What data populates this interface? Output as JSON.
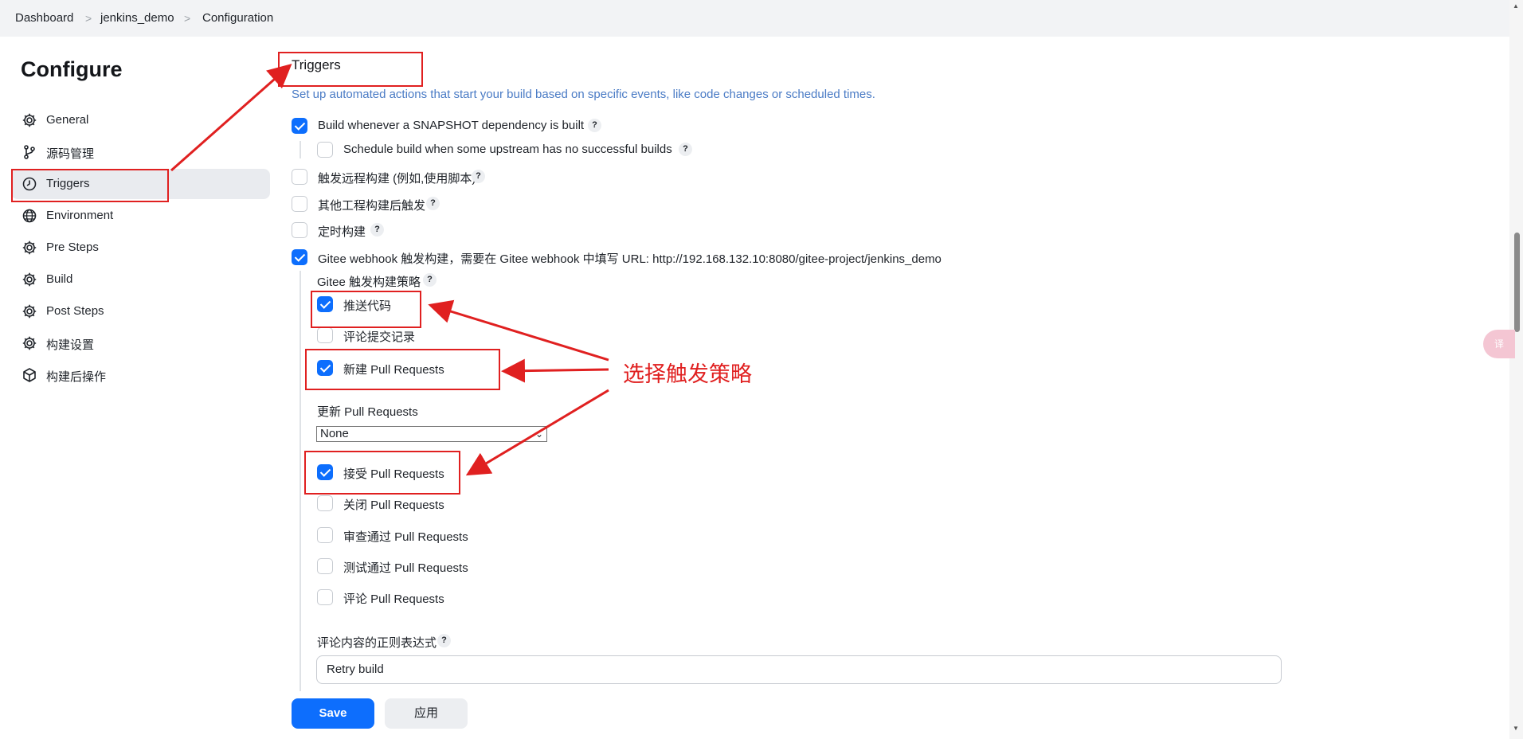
{
  "breadcrumb": [
    "Dashboard",
    "jenkins_demo",
    "Configuration"
  ],
  "breadcrumb_separator": ">",
  "sidebar": {
    "title": "Configure",
    "items": [
      {
        "label": "General",
        "icon": "gear-icon"
      },
      {
        "label": "源码管理",
        "icon": "branch-icon"
      },
      {
        "label": "Triggers",
        "icon": "clock-icon",
        "active": true
      },
      {
        "label": "Environment",
        "icon": "globe-icon"
      },
      {
        "label": "Pre Steps",
        "icon": "gear-icon"
      },
      {
        "label": "Build",
        "icon": "gear-icon"
      },
      {
        "label": "Post Steps",
        "icon": "gear-icon"
      },
      {
        "label": "构建设置",
        "icon": "gear-icon"
      },
      {
        "label": "构建后操作",
        "icon": "cube-icon"
      }
    ]
  },
  "section": {
    "title": "Triggers",
    "description": "Set up automated actions that start your build based on specific events, like code changes or scheduled times."
  },
  "triggers": {
    "snapshot": {
      "label": "Build whenever a SNAPSHOT dependency is built",
      "checked": true
    },
    "upstream": {
      "label": "Schedule build when some upstream has no successful builds",
      "checked": false
    },
    "remote": {
      "label": "触发远程构建 (例如,使用脚本)",
      "checked": false
    },
    "after_other": {
      "label": "其他工程构建后触发",
      "checked": false
    },
    "scheduled": {
      "label": "定时构建",
      "checked": false
    },
    "gitee": {
      "label": "Gitee webhook 触发构建，需要在 Gitee webhook 中填写 URL: http://192.168.132.10:8080/gitee-project/jenkins_demo",
      "checked": true
    }
  },
  "gitee": {
    "strategy_label": "Gitee 触发构建策略",
    "push": {
      "label": "推送代码",
      "checked": true
    },
    "comment_commit": {
      "label": "评论提交记录",
      "checked": false
    },
    "new_pr": {
      "label": "新建 Pull Requests",
      "checked": true
    },
    "update_pr_label": "更新 Pull Requests",
    "update_pr_value": "None",
    "accept_pr": {
      "label": "接受 Pull Requests",
      "checked": true
    },
    "close_pr": {
      "label": "关闭 Pull Requests",
      "checked": false
    },
    "review_pr": {
      "label": "审查通过 Pull Requests",
      "checked": false
    },
    "test_pr": {
      "label": "测试通过 Pull Requests",
      "checked": false
    },
    "comment_pr": {
      "label": "评论 Pull Requests",
      "checked": false
    },
    "regex_label": "评论内容的正则表达式",
    "regex_value": "Retry build"
  },
  "help_mark": "?",
  "buttons": {
    "save": "Save",
    "apply": "应用"
  },
  "translate_fab": "译",
  "annotation": {
    "text": "选择触发策略",
    "color": "#e02020"
  },
  "colors": {
    "accent": "#0d6efd",
    "link_text": "#4a7bc5",
    "annotation": "#e02020"
  }
}
